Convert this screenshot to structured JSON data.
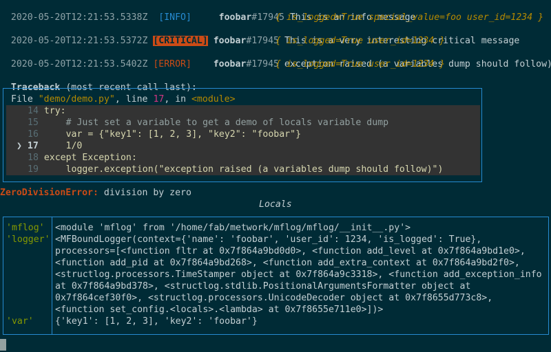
{
  "log": [
    {
      "timestamp": "2020-05-20T12:21:53.5338Z",
      "level": "[INFO]",
      "host": "foobar",
      "pid": "#17945",
      "message": "This is an info message",
      "context": "{ is_logged=True special_value=foo user_id=1234 }"
    },
    {
      "timestamp": "2020-05-20T12:21:53.5372Z",
      "level": "[CRITICAL]",
      "host": "foobar",
      "pid": "#17945",
      "message": "This is a very interesting critical message",
      "context": "{ is_logged=True user_id=1234 }"
    },
    {
      "timestamp": "2020-05-20T12:21:53.5402Z",
      "level": "[ERROR]",
      "host": "foobar",
      "pid": "#17945",
      "message": "exception raised (a variables dump should follow)",
      "context": "{ is_logged=True user_id=1234 }"
    }
  ],
  "traceback": {
    "title": "Traceback",
    "subtitle": "(most recent call last):",
    "file_prefix": "File ",
    "file_name": "\"demo/demo.py\"",
    "line_word": ", line ",
    "line_no": "17",
    "in_word": ", in ",
    "module": "<module>",
    "lines": [
      {
        "no": "14",
        "text": "try:"
      },
      {
        "no": "15",
        "text": "    # Just set a variable to get a demo of locals variable dump"
      },
      {
        "no": "16",
        "text": "    var = {\"key1\": [1, 2, 3], \"key2\": \"foobar\"}"
      },
      {
        "no": "17",
        "text": "    1/0",
        "marker": "❯"
      },
      {
        "no": "18",
        "text": "except Exception:"
      },
      {
        "no": "19",
        "text": "    logger.exception(\"exception raised (a variables dump should follow)\")"
      }
    ]
  },
  "error": {
    "type": "ZeroDivisionError:",
    "message": "division by zero"
  },
  "locals": {
    "title": "Locals",
    "names": [
      "'mflog'",
      "'logger'",
      "'var'"
    ],
    "mflog_value": "<module 'mflog' from '/home/fab/metwork/mflog/mflog/__init__.py'>",
    "logger_value_lines": [
      "<MFBoundLogger(context={'name': 'foobar', 'user_id': 1234, 'is_logged': True},",
      "processors=[<function fltr at 0x7f864a9bd0d0>, <function add_level at 0x7f864a9bd1e0>,",
      "<function add_pid at 0x7f864a9bd268>, <function add_extra_context at 0x7f864a9bd2f0>,",
      "<structlog.processors.TimeStamper object at 0x7f864a9c3318>, <function add_exception_info",
      "at 0x7f864a9bd378>, <structlog.stdlib.PositionalArgumentsFormatter object at",
      "0x7f864cef30f0>, <structlog.processors.UnicodeDecoder object at 0x7f8655d773c8>,",
      "<function set_config.<locals>.<lambda> at 0x7f8655e711e0>])>"
    ],
    "var_value": "{'key1': [1, 2, 3], 'key2': 'foobar'}"
  }
}
